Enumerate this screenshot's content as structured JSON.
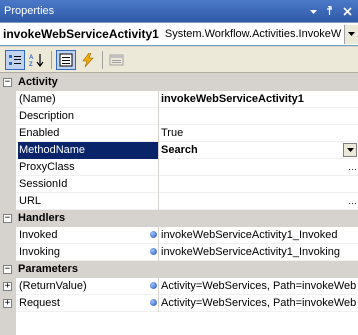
{
  "window": {
    "title": "Properties"
  },
  "object_selector": {
    "name": "invokeWebServiceActivity1",
    "type": "System.Workflow.Activities.InvokeW"
  },
  "toolbar": {
    "buttons": [
      "categorized-icon",
      "alphabetical-icon",
      "properties-icon",
      "events-icon",
      "property-pages-icon"
    ]
  },
  "categories": {
    "activity": "Activity",
    "handlers": "Handlers",
    "parameters": "Parameters"
  },
  "rows": {
    "name": {
      "label": "(Name)",
      "value": "invokeWebServiceActivity1"
    },
    "description": {
      "label": "Description",
      "value": ""
    },
    "enabled": {
      "label": "Enabled",
      "value": "True"
    },
    "methodname": {
      "label": "MethodName",
      "value": "Search"
    },
    "proxyclass": {
      "label": "ProxyClass",
      "value": ""
    },
    "sessionid": {
      "label": "SessionId",
      "value": ""
    },
    "url": {
      "label": "URL",
      "value": ""
    },
    "invoked": {
      "label": "Invoked",
      "value": "invokeWebServiceActivity1_Invoked"
    },
    "invoking": {
      "label": "Invoking",
      "value": "invokeWebServiceActivity1_Invoking"
    },
    "returnvalue": {
      "label": "(ReturnValue)",
      "value": "Activity=WebServices, Path=invokeWeb"
    },
    "request": {
      "label": "Request",
      "value": "Activity=WebServices, Path=invokeWeb"
    }
  },
  "colors": {
    "selection": "#0a246a",
    "title_bar": "#2f5aa8",
    "category_bg": "#d6d3ce"
  }
}
